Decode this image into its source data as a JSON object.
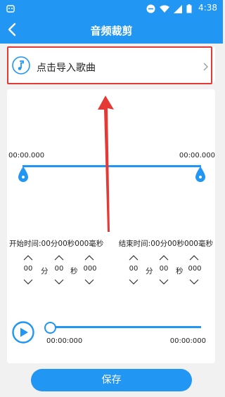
{
  "status_bar": {
    "time": "4:38"
  },
  "app_bar": {
    "title": "音频裁剪"
  },
  "import": {
    "label": "点击导入歌曲"
  },
  "range": {
    "start_time": "00:00.000",
    "end_time": "00:00.000"
  },
  "start": {
    "label": "开始时间:00分00秒000毫秒",
    "minutes": "00",
    "seconds": "00",
    "millis": "000",
    "unit_min": "分",
    "unit_sec": "秒"
  },
  "end": {
    "label": "结束时间:00分00秒000毫秒",
    "minutes": "00",
    "seconds": "00",
    "millis": "000",
    "unit_min": "分",
    "unit_sec": "秒"
  },
  "player": {
    "current_time": "00:00:000",
    "total_time": "00:00:000",
    "progress": 0
  },
  "actions": {
    "save_label": "保存"
  },
  "colors": {
    "accent": "#2196f3",
    "highlight": "#e53935"
  }
}
